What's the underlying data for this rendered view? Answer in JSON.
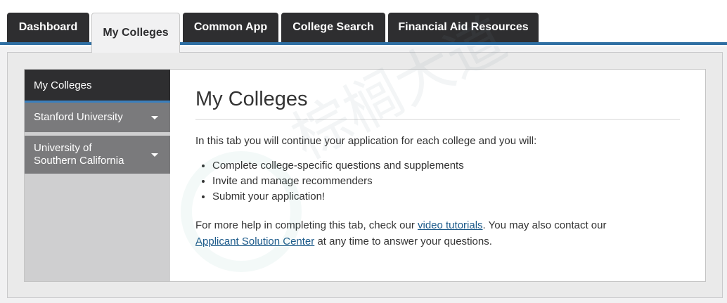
{
  "tabs": [
    {
      "label": "Dashboard",
      "active": false
    },
    {
      "label": "My Colleges",
      "active": true
    },
    {
      "label": "Common App",
      "active": false
    },
    {
      "label": "College Search",
      "active": false
    },
    {
      "label": "Financial Aid Resources",
      "active": false
    }
  ],
  "sidebar": {
    "header": "My Colleges",
    "items": [
      {
        "label": "Stanford University",
        "icon": "chevron-down-icon"
      },
      {
        "label": "University of Southern California",
        "icon": "chevron-down-icon"
      }
    ]
  },
  "main": {
    "title": "My Colleges",
    "intro": "In this tab you will continue your application for each college and you will:",
    "bullets": [
      "Complete college-specific questions and supplements",
      "Invite and manage recommenders",
      "Submit your application!"
    ],
    "help_before": "For more help in completing this tab, check our ",
    "help_link_1": "video tutorials",
    "help_middle": ". You may also contact our ",
    "help_link_2": "Applicant Solution Center",
    "help_after": " at any time to answer your questions."
  },
  "watermark": "棕榈大道",
  "colors": {
    "tab_dark": "#2e2e30",
    "accent_line": "#2f6fa3",
    "sidebar_item": "#7a7a7c",
    "link": "#1c5a8a"
  }
}
